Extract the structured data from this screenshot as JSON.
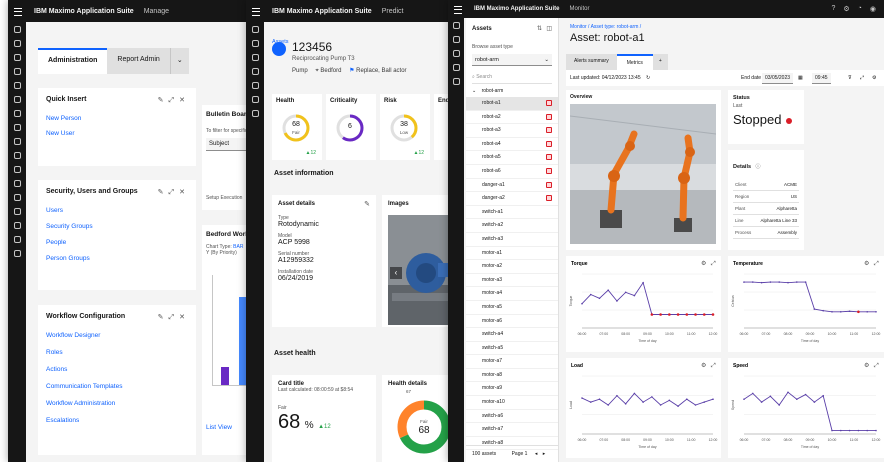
{
  "w1": {
    "brand": "IBM Maximo Application Suite",
    "context": "Manage",
    "tabs": [
      "Administration",
      "Report Admin"
    ],
    "quick_insert": {
      "title": "Quick Insert",
      "links": [
        "New Person",
        "New User"
      ]
    },
    "security": {
      "title": "Security, Users and Groups",
      "links": [
        "Users",
        "Security Groups",
        "People",
        "Person Groups"
      ]
    },
    "workflow": {
      "title": "Workflow Configuration",
      "links": [
        "Workflow Designer",
        "Roles",
        "Actions",
        "Communication Templates",
        "Workflow Administration",
        "Escalations"
      ]
    },
    "bulletin": {
      "title": "Bulletin Board",
      "hint": "To filter for specific",
      "select": "Subject",
      "expand": "Setup Execution"
    },
    "bedford": {
      "title": "Bedford Work Orders",
      "chart_type_label": "Chart Type:",
      "chart_type": "BAR",
      "chart_sub": "Y (By Priority)",
      "list_view": "List View"
    }
  },
  "w2": {
    "brand": "IBM Maximo Application Suite",
    "context": "Predict",
    "breadcrumb": "Assets",
    "asset_id": "123456",
    "asset_desc": "Reciprocating Pump T3",
    "meta": [
      "Pump",
      "Bedford",
      "Replace, Ball actor"
    ],
    "scores": [
      {
        "label": "Health",
        "value": "68",
        "sub": "Fair",
        "delta": "12"
      },
      {
        "label": "Criticality",
        "value": "6",
        "sub": "",
        "delta": ""
      },
      {
        "label": "Risk",
        "value": "38",
        "sub": "Low",
        "delta": "12"
      }
    ],
    "end_label": "End",
    "info_title": "Asset information",
    "details_title": "Asset details",
    "details": [
      {
        "label": "Type",
        "value": "Rotodynamic"
      },
      {
        "label": "Model",
        "value": "ACP 5998"
      },
      {
        "label": "Serial number",
        "value": "A12959332"
      },
      {
        "label": "Installation date",
        "value": "06/24/2019"
      }
    ],
    "images_title": "Images",
    "health_title": "Asset health",
    "card": {
      "title": "Card title",
      "sub": "Last calculated: 08:00:59 at $8:54",
      "label": "Fair",
      "value": "68",
      "unit": "%",
      "delta": "12"
    },
    "health_details_title": "Health details",
    "donut": {
      "value": "68",
      "label": "Fair",
      "top": "67"
    }
  },
  "w3": {
    "brand": "IBM Maximo Application Suite",
    "context": "Monitor",
    "assets_label": "Assets",
    "browse_label": "Browse asset type",
    "asset_type": "robot-arm",
    "search_placeholder": "Search",
    "tree_root": "robot-arm",
    "items": [
      "robot-a1",
      "robot-a2",
      "robot-a3",
      "robot-a4",
      "robot-a5",
      "robot-a6",
      "danger-a1",
      "danger-a2",
      "switch-a1",
      "switch-a2",
      "switch-a3",
      "motor-a1",
      "motor-a2",
      "motor-a3",
      "motor-a4",
      "motor-a5",
      "motor-a6",
      "switch-a4",
      "switch-a5",
      "motor-a7",
      "motor-a8",
      "motor-a9",
      "motor-a10",
      "switch-a6",
      "switch-a7",
      "switch-a8"
    ],
    "footer": {
      "count": "100 assets",
      "page": "Page 1"
    },
    "breadcrumb": "Monitor / Asset type: robot-arm /",
    "title": "Asset: robot-a1",
    "tabs": [
      "Alerts summary",
      "Metrics"
    ],
    "updated": "Last updated: 04/12/2023 13:45",
    "date_label": "End date",
    "date": "03/05/2023",
    "time": "09:45",
    "overview_title": "Overview",
    "status": {
      "title": "Status",
      "sub": "Last",
      "value": "Stopped",
      "color": "#da1e28"
    },
    "details_title": "Details",
    "details": [
      {
        "key": "Client",
        "value": "ACME"
      },
      {
        "key": "Region",
        "value": "US"
      },
      {
        "key": "Plant",
        "value": "Alpharetta"
      },
      {
        "key": "Line",
        "value": "Alpharetta Line 33"
      },
      {
        "key": "Process",
        "value": "Assembly"
      }
    ],
    "ticks": [
      "06:00",
      "07:00",
      "08:00",
      "09:00",
      "10:00",
      "11:00",
      "12:00"
    ],
    "x_title": "Time of day",
    "charts": [
      {
        "title": "Torque",
        "ylabel": "Torque",
        "values": [
          0.45,
          0.62,
          0.55,
          0.7,
          0.5,
          0.66,
          0.6,
          0.84,
          0.25,
          0.25,
          0.25,
          0.25,
          0.25,
          0.25,
          0.25,
          0.25
        ]
      },
      {
        "title": "Temperature",
        "ylabel": "Celsius",
        "values": [
          0.85,
          0.85,
          0.84,
          0.85,
          0.85,
          0.84,
          0.85,
          0.85,
          0.35,
          0.32,
          0.3,
          0.3,
          0.31,
          0.3,
          0.3,
          0.3
        ]
      },
      {
        "title": "Load",
        "ylabel": "Load",
        "values": [
          0.62,
          0.55,
          0.6,
          0.5,
          0.66,
          0.52,
          0.7,
          0.55,
          0.64,
          0.5,
          0.58,
          0.48,
          0.6,
          0.5,
          0.55,
          0.6
        ]
      },
      {
        "title": "Speed",
        "ylabel": "Speed",
        "values": [
          0.6,
          0.7,
          0.55,
          0.65,
          0.5,
          0.72,
          0.6,
          0.68,
          0.55,
          0.66,
          0.06,
          0.06,
          0.06,
          0.06,
          0.06,
          0.06
        ]
      }
    ],
    "colors": {
      "line": "#5a3fa8",
      "alert": "#da1e28",
      "accent": "#0f62fe"
    }
  }
}
